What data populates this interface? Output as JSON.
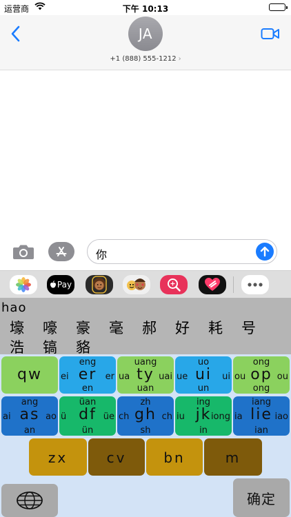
{
  "status_bar": {
    "carrier": "运营商",
    "time": "下午 10:13"
  },
  "header": {
    "avatar_initials": "JA",
    "contact": "+1 (888) 555-1212",
    "chevron": "›"
  },
  "compose": {
    "text": "你"
  },
  "drawer": {
    "apple_pay": "Pay"
  },
  "candidates": {
    "pinyin": "hao",
    "row1": [
      "壕",
      "嚎",
      "豪",
      "毫",
      "郝",
      "好",
      "耗",
      "号"
    ],
    "row2": [
      "浩",
      "镐",
      "貉"
    ]
  },
  "keyboard": {
    "row1": [
      {
        "main": "qw"
      },
      {
        "main": "er",
        "sup": "eng",
        "left": "ei",
        "right": "er",
        "sub": "en"
      },
      {
        "main": "ty",
        "sup": "uang",
        "left": "ua",
        "right": "uai",
        "sub": "uan"
      },
      {
        "main": "ui",
        "sup": "uo",
        "left": "ue",
        "right": "ui",
        "sub": "un"
      },
      {
        "main": "op",
        "sup": "ong",
        "left": "ou",
        "right": "ou",
        "sub": "ong"
      }
    ],
    "row2": [
      {
        "main": "as",
        "sup": "ang",
        "left": "ai",
        "right": "ao",
        "sub": "an"
      },
      {
        "main": "df",
        "sup": "üan",
        "left": "ü",
        "right": "üe",
        "sub": "ün"
      },
      {
        "main": "gh",
        "sup": "zh",
        "left": "ch",
        "right": "ch",
        "sub": "sh"
      },
      {
        "main": "jk",
        "sup": "ing",
        "left": "iu",
        "right": "iong",
        "sub": "in"
      },
      {
        "main": "lie",
        "sup": "iang",
        "left": "ia",
        "right": "iao",
        "sub": "ian"
      }
    ],
    "row3": [
      "zx",
      "cv",
      "bn",
      "m"
    ],
    "confirm": "确定"
  }
}
